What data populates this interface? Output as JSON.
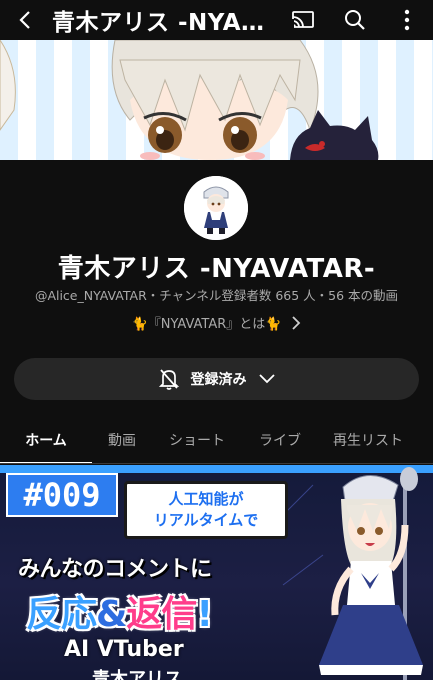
{
  "appbar": {
    "title": "青木アリス -NYA…",
    "icons": [
      "back-arrow-icon",
      "cast-icon",
      "search-icon",
      "more-vert-icon"
    ]
  },
  "channel": {
    "name": "青木アリス -NYAVATAR-",
    "meta": "@Alice_NYAVATAR・チャンネル登録者数 665 人・56 本の動画",
    "link_text": "🐈『NYAVATAR』とは🐈",
    "subscribe_label": "登録済み"
  },
  "tabs": [
    {
      "label": "ホーム",
      "active": true
    },
    {
      "label": "動画",
      "active": false
    },
    {
      "label": "ショート",
      "active": false
    },
    {
      "label": "ライブ",
      "active": false
    },
    {
      "label": "再生リスト",
      "active": false
    }
  ],
  "thumbnail": {
    "episode": "#009",
    "bubble_line1": "人工知能が",
    "bubble_line2": "リアルタイムで",
    "headline1": "みんなのコメントに",
    "headline2_a": "反応",
    "headline2_amp": "&",
    "headline2_b": "返信",
    "headline2_c": "!",
    "subline1": "AI VTuber",
    "subline2": "青木アリス"
  },
  "colors": {
    "background": "#0f0f0f",
    "button_bg": "#272727",
    "accent_blue": "#3aa0ff"
  }
}
